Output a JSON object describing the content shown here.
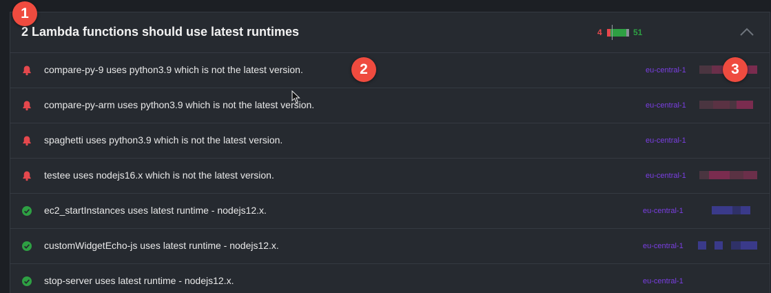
{
  "panel": {
    "title": "2 Lambda functions should use latest runtimes",
    "failed_count": "4",
    "passed_count": "51",
    "collapse_icon": "chevron-up-icon"
  },
  "rows": [
    {
      "status": "alert",
      "icon": "bell-icon",
      "text": "compare-py-9 uses python3.9 which is not the latest version.",
      "region": "eu-central-1"
    },
    {
      "status": "alert",
      "icon": "bell-icon",
      "text": "compare-py-arm uses python3.9 which is not the latest version.",
      "region": "eu-central-1"
    },
    {
      "status": "alert",
      "icon": "bell-icon",
      "text": "spaghetti uses python3.9 which is not the latest version.",
      "region": "eu-central-1"
    },
    {
      "status": "alert",
      "icon": "bell-icon",
      "text": "testee uses nodejs16.x which is not the latest version.",
      "region": "eu-central-1"
    },
    {
      "status": "ok",
      "icon": "check-circle-icon",
      "text": "ec2_startInstances uses latest runtime - nodejs12.x.",
      "region": "eu-central-1"
    },
    {
      "status": "ok",
      "icon": "check-circle-icon",
      "text": "customWidgetEcho-js uses latest runtime - nodejs12.x.",
      "region": "eu-central-1"
    },
    {
      "status": "ok",
      "icon": "check-circle-icon",
      "text": "stop-server uses latest runtime - nodejs12.x.",
      "region": "eu-central-1"
    }
  ],
  "annotations": [
    "1",
    "2",
    "3"
  ],
  "colors": {
    "alert": "#e5484d",
    "ok": "#2ea043",
    "region": "#7b3fe4",
    "badge": "#ef4b3f"
  }
}
